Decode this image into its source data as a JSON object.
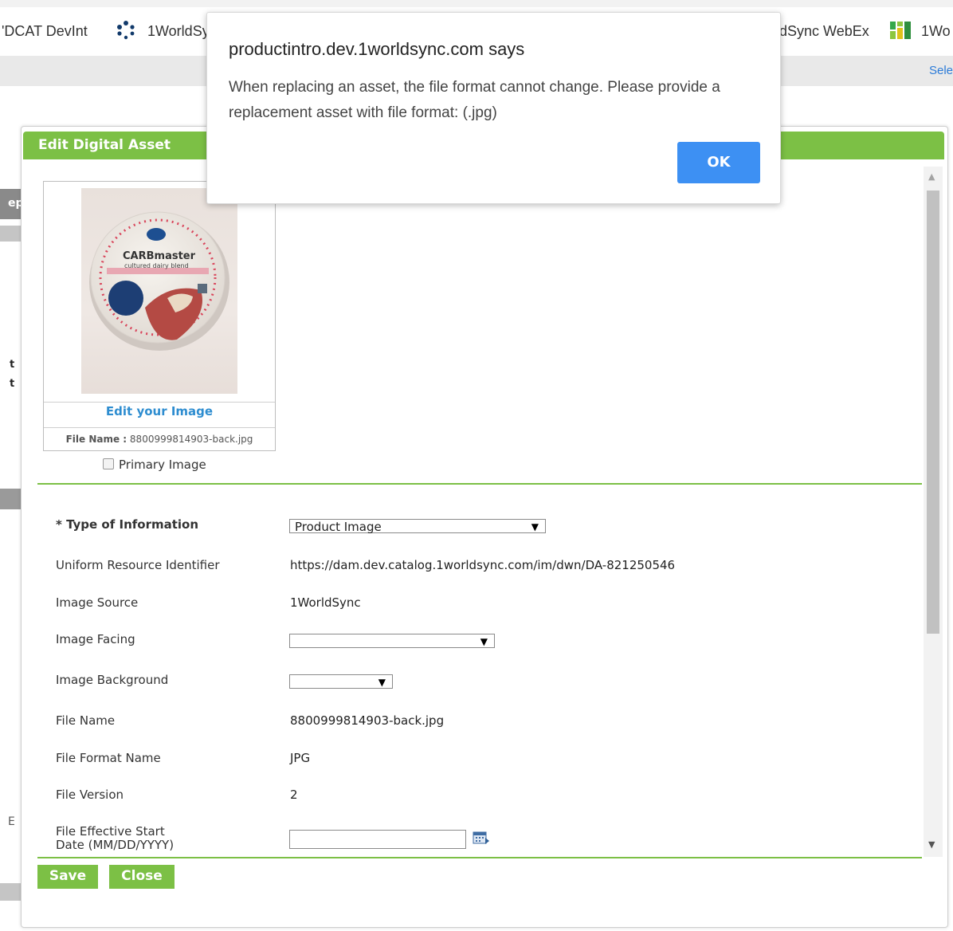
{
  "bookmarks": {
    "items": [
      {
        "label": "'DCAT DevInt"
      },
      {
        "label": "1WorldSy"
      },
      {
        "label": "dSync WebEx"
      },
      {
        "label": "1Wo"
      }
    ]
  },
  "app": {
    "select_link": "Sele",
    "left_fragments": [
      "ep",
      "t",
      "t",
      "E"
    ]
  },
  "alert": {
    "title": "productintro.dev.1worldsync.com says",
    "message": "When replacing an asset, the file format cannot change. Please provide a replacement asset with file format: (.jpg)",
    "ok_label": "OK"
  },
  "dialog": {
    "title": "Edit Digital Asset",
    "image": {
      "edit_link": "Edit your Image",
      "file_name_label": "File Name :",
      "file_name_value": "8800999814903-back.jpg",
      "thumb_text": [
        "CARBmaster",
        "cultured dairy blend"
      ]
    },
    "primary_label": "Primary Image",
    "fields": {
      "type_of_information": {
        "label": "* Type of Information",
        "value": "Product Image"
      },
      "uri": {
        "label": "Uniform Resource Identifier",
        "value": "https://dam.dev.catalog.1worldsync.com/im/dwn/DA-821250546"
      },
      "image_source": {
        "label": "Image Source",
        "value": "1WorldSync"
      },
      "image_facing": {
        "label": "Image Facing",
        "value": ""
      },
      "image_background": {
        "label": "Image Background",
        "value": ""
      },
      "file_name": {
        "label": "File Name",
        "value": "8800999814903-back.jpg"
      },
      "file_format": {
        "label": "File Format Name",
        "value": "JPG"
      },
      "file_version": {
        "label": "File Version",
        "value": "2"
      },
      "start_date": {
        "label_line1": "File Effective Start",
        "label_line2": "Date (MM/DD/YYYY)",
        "value": ""
      }
    },
    "buttons": {
      "save": "Save",
      "close": "Close"
    }
  },
  "colors": {
    "accent_green": "#7cc045",
    "ok_blue": "#3d90f3",
    "link_blue": "#2e8dd0"
  }
}
